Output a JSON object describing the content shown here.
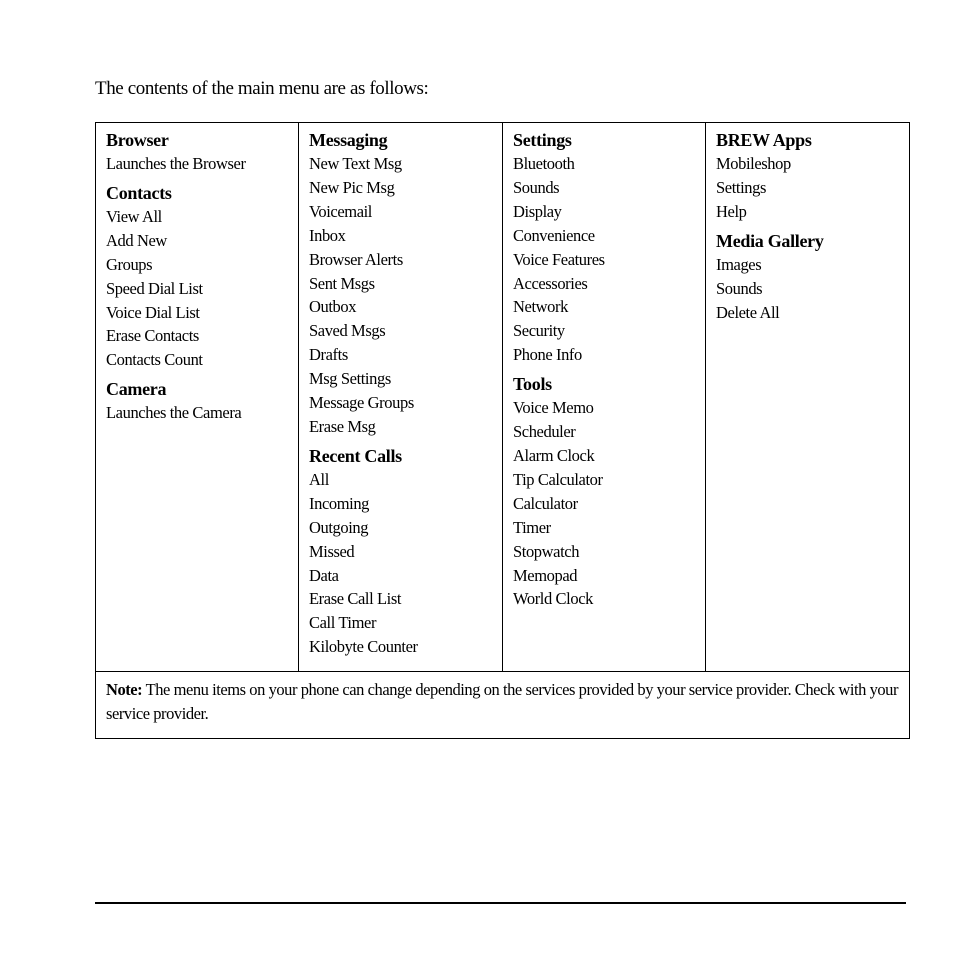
{
  "intro": "The contents of the main menu are as follows:",
  "columns": [
    {
      "groups": [
        {
          "title": "Browser",
          "items": [
            "Launches the Browser"
          ]
        },
        {
          "title": "Contacts",
          "items": [
            "View All",
            "Add New",
            "Groups",
            "Speed Dial List",
            "Voice Dial List",
            "Erase Contacts",
            "Contacts Count"
          ]
        },
        {
          "title": "Camera",
          "items": [
            "Launches the Camera"
          ]
        }
      ]
    },
    {
      "groups": [
        {
          "title": "Messaging",
          "items": [
            "New Text Msg",
            "New Pic Msg",
            "Voicemail",
            "Inbox",
            "Browser Alerts",
            "Sent Msgs",
            "Outbox",
            "Saved Msgs",
            "Drafts",
            "Msg Settings",
            "Message Groups",
            "Erase Msg"
          ]
        },
        {
          "title": "Recent Calls",
          "items": [
            "All",
            "Incoming",
            "Outgoing",
            "Missed",
            "Data",
            "Erase Call List",
            "Call Timer",
            "Kilobyte Counter"
          ]
        }
      ]
    },
    {
      "groups": [
        {
          "title": "Settings",
          "items": [
            "Bluetooth",
            "Sounds",
            "Display",
            "Convenience",
            "Voice Features",
            "Accessories",
            "Network",
            "Security",
            "Phone Info"
          ]
        },
        {
          "title": "Tools",
          "items": [
            "Voice Memo",
            "Scheduler",
            "Alarm Clock",
            "Tip Calculator",
            "Calculator",
            "Timer",
            "Stopwatch",
            "Memopad",
            "World Clock"
          ]
        }
      ]
    },
    {
      "groups": [
        {
          "title": "BREW Apps",
          "items": [
            "Mobileshop",
            "Settings",
            "Help"
          ]
        },
        {
          "title": "Media Gallery",
          "items": [
            "Images",
            "Sounds",
            "Delete All"
          ]
        }
      ]
    }
  ],
  "note": {
    "label": "Note:",
    "text": " The menu items on your phone can change depending on the services provided by your service provider. Check with your service provider."
  }
}
